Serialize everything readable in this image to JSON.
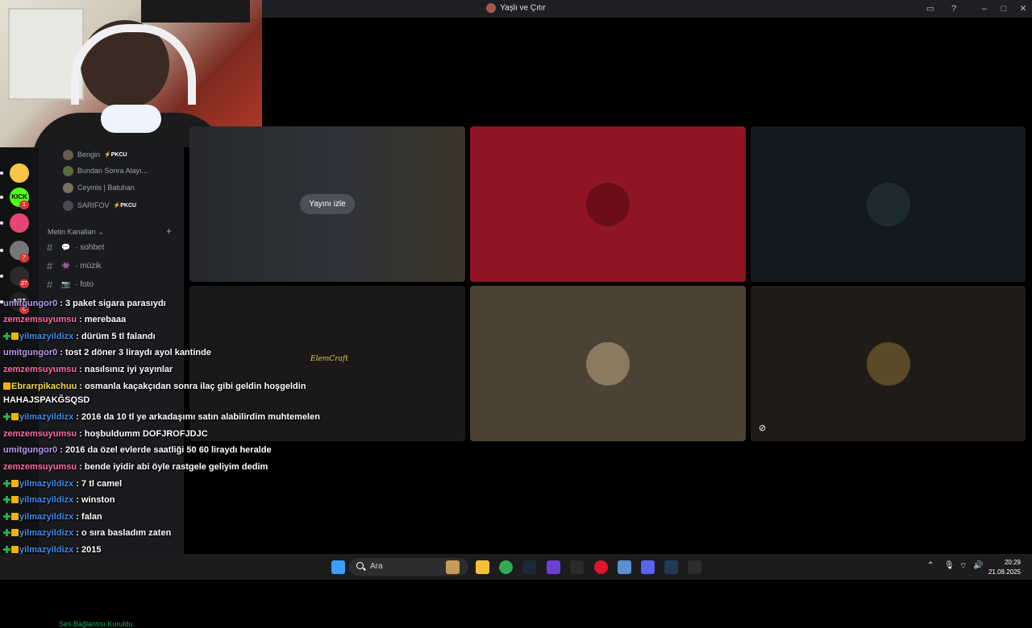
{
  "window": {
    "title": "Yaşlı ve Çıtır",
    "inbox_icon": "inbox-icon",
    "help_icon": "help-icon",
    "minimize": "–",
    "maximize": "□",
    "close": "✕"
  },
  "servers": [
    {
      "name": "mascot-server",
      "color": "#f7c548"
    },
    {
      "name": "KICK",
      "color": "#53fc18",
      "badge": "1"
    },
    {
      "name": "pink-server",
      "color": "#e84577"
    },
    {
      "name": "avatar-server",
      "color": "#777777",
      "badge": "7"
    },
    {
      "name": "q-server",
      "color": "#2b2b2b",
      "badge": "27"
    },
    {
      "name": "ART",
      "color": "#222222",
      "badge": "6"
    }
  ],
  "members": [
    {
      "name": "Bengin",
      "tag": "⚡PKCU",
      "avatar_color": "#6a5a4a"
    },
    {
      "name": "Bundan Sonra Alayı...",
      "tag": "",
      "avatar_color": "#5b6b3b"
    },
    {
      "name": "Ceymis | Batuhan",
      "tag": "",
      "avatar_color": "#7a7060"
    },
    {
      "name": "SARIFOV",
      "tag": "⚡PKCU",
      "avatar_color": "#4a4a55"
    }
  ],
  "text_channels": {
    "title": "Metin Kanalları",
    "items": [
      {
        "emoji": "💬",
        "name": "sohbet"
      },
      {
        "emoji": "👾",
        "name": "müzik"
      },
      {
        "emoji": "📷",
        "name": "foto"
      }
    ]
  },
  "voice_status": "Ses Bağlantısı Kuruldu",
  "stream": {
    "watch_label": "Yayını izle"
  },
  "tiles": [
    {
      "name": "stream",
      "bg": "#2b2d31"
    },
    {
      "name": "red-user",
      "bg": "#8f1525",
      "avatar_color": "#6b0d18"
    },
    {
      "name": "dark-user",
      "bg": "#131a1f",
      "avatar_color": "#1d2a30"
    },
    {
      "name": "logo-user",
      "bg": "#1a1917",
      "logo": "ElemCraft"
    },
    {
      "name": "brown-user",
      "bg": "#4b4233",
      "avatar_color": "#8a7a60"
    },
    {
      "name": "king-user",
      "bg": "#1f1c17",
      "avatar_color": "#5a4a28"
    }
  ],
  "chat": [
    {
      "user": "umitgungor0",
      "color": "#b99cf0",
      "icons": [],
      "msg": ": 3 paket sigara parasıydı"
    },
    {
      "user": "zemzemsuyumsu",
      "color": "#ff6ea8",
      "icons": [],
      "msg": ": merebaaa"
    },
    {
      "user": "yilmazyildizx",
      "color": "#3f8cf0",
      "icons": [
        "g",
        "y"
      ],
      "msg": ": dürüm 5 tl falandı"
    },
    {
      "user": "umitgungor0",
      "color": "#b99cf0",
      "icons": [],
      "msg": ": tost 2 döner 3 liraydı ayol kantinde"
    },
    {
      "user": "zemzemsuyumsu",
      "color": "#ff6ea8",
      "icons": [],
      "msg": ": nasılsınız iyi yayınlar"
    },
    {
      "user": "Ebrarrpikachuu",
      "color": "#f5d94a",
      "icons": [
        "y"
      ],
      "msg": ": osmanla kaçakçıdan sonra ilaç gibi geldin hoşgeldin"
    },
    {
      "user": "",
      "color": "#ffffff",
      "icons": [],
      "msg": "HAHAJSPAKĞSQSD"
    },
    {
      "user": "yilmazyildizx",
      "color": "#3f8cf0",
      "icons": [
        "g",
        "y"
      ],
      "msg": ": 2016 da 10 tl ye arkadaşımı satın alabilirdim muhtemelen"
    },
    {
      "user": "zemzemsuyumsu",
      "color": "#ff6ea8",
      "icons": [],
      "msg": ": hoşbuldumm DOFJROFJDJC"
    },
    {
      "user": "umitgungor0",
      "color": "#b99cf0",
      "icons": [],
      "msg": ": 2016 da özel evlerde saatliği 50 60 liraydı heralde"
    },
    {
      "user": "zemzemsuyumsu",
      "color": "#ff6ea8",
      "icons": [],
      "msg": ": bende iyidir abi öyle rastgele geliyim dedim"
    },
    {
      "user": "yilmazyildizx",
      "color": "#3f8cf0",
      "icons": [
        "g",
        "y"
      ],
      "msg": ": 7 tl camel"
    },
    {
      "user": "yilmazyildizx",
      "color": "#3f8cf0",
      "icons": [
        "g",
        "y"
      ],
      "msg": ": winston"
    },
    {
      "user": "yilmazyildizx",
      "color": "#3f8cf0",
      "icons": [
        "g",
        "y"
      ],
      "msg": ": falan"
    },
    {
      "user": "yilmazyildizx",
      "color": "#3f8cf0",
      "icons": [
        "g",
        "y"
      ],
      "msg": ": o sıra basladım zaten"
    },
    {
      "user": "yilmazyildizx",
      "color": "#3f8cf0",
      "icons": [
        "g",
        "y"
      ],
      "msg": ": 2015"
    }
  ],
  "taskbar": {
    "search_placeholder": "Ara",
    "apps": [
      {
        "name": "windows-start-icon",
        "color": "#3aa0ff"
      },
      {
        "name": "search-decoration-icon",
        "color": "#c79a5a"
      },
      {
        "name": "file-explorer-icon",
        "color": "#f3c13a"
      },
      {
        "name": "chrome-icon",
        "color": "#34a853"
      },
      {
        "name": "steam-icon",
        "color": "#1b2838"
      },
      {
        "name": "purple-app-icon",
        "color": "#6a3fd0"
      },
      {
        "name": "epic-games-icon",
        "color": "#2a2a2a"
      },
      {
        "name": "opera-icon",
        "color": "#e0142d"
      },
      {
        "name": "settings-app-icon",
        "color": "#5a8fd0"
      },
      {
        "name": "discord-icon",
        "color": "#5865f2"
      },
      {
        "name": "steam2-icon",
        "color": "#223a55"
      },
      {
        "name": "obs-icon",
        "color": "#2d2d2d"
      }
    ],
    "time": "20:29",
    "date": "21.08.2025"
  }
}
